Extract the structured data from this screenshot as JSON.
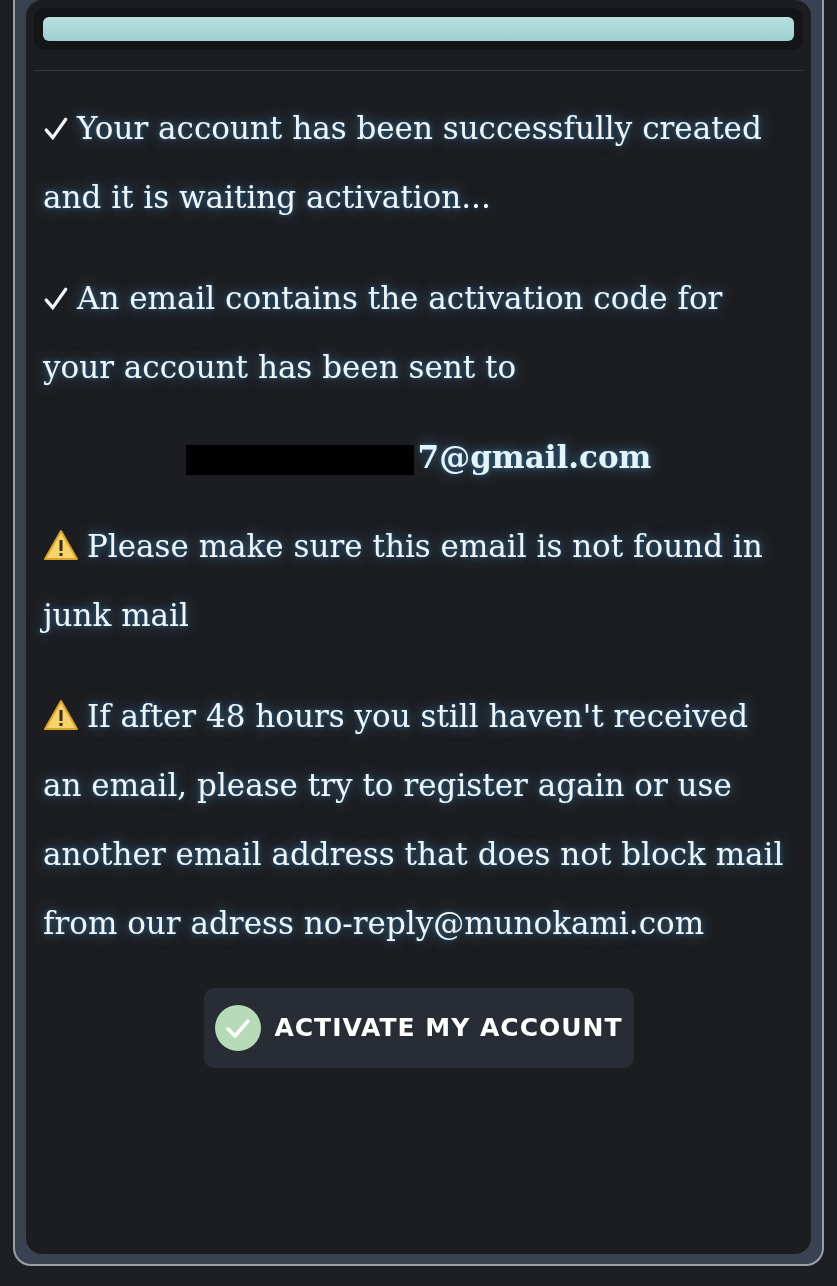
{
  "messages": [
    {
      "kind": "check",
      "text": "Your account has been successfully created and it is waiting activation..."
    },
    {
      "kind": "check",
      "text": "An email contains the activation code for your account has been sent to"
    },
    {
      "kind": "email",
      "text": "7@gmail.com",
      "redacted": true
    },
    {
      "kind": "warning",
      "text": "Please make sure this email is not found in junk mail"
    },
    {
      "kind": "warning",
      "text": "If after 48 hours you still haven't received an email, please try to register again or use another email address that does not block mail from our adress no-reply@munokami.com"
    }
  ],
  "button": {
    "label": "ACTIVATE MY ACCOUNT"
  }
}
